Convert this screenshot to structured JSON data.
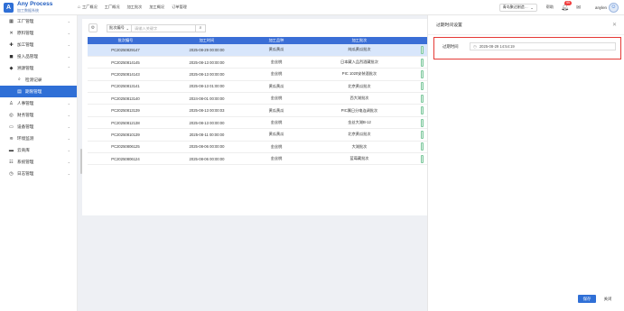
{
  "app": {
    "logo_mark": "A",
    "title": "Any Process",
    "subtitle": "加工数据系统"
  },
  "topnav": [
    {
      "icon": "⌂",
      "label": "工厂概况"
    },
    {
      "icon": "",
      "label": "工厂概况"
    },
    {
      "icon": "",
      "label": "加工批次"
    },
    {
      "icon": "",
      "label": "加工概况"
    },
    {
      "icon": "",
      "label": "订单管理"
    }
  ],
  "header": {
    "factory": "青岛聚达制造…",
    "help": "帮助",
    "notification_count": "99",
    "user": "anylen"
  },
  "sidebar": {
    "items": [
      {
        "icon": "▦",
        "label": "工厂管理",
        "chev": "⌄"
      },
      {
        "icon": "✕",
        "label": "原料管理",
        "chev": "⌄"
      },
      {
        "icon": "✚",
        "label": "加工管理",
        "chev": "⌄"
      },
      {
        "icon": "◼",
        "label": "投入品管理",
        "chev": "⌄"
      },
      {
        "icon": "◆",
        "label": "溯源管理",
        "chev": "⌃"
      },
      {
        "icon": "⌕",
        "label": "检测记录",
        "chev": ""
      },
      {
        "icon": "▤",
        "label": "期限管理",
        "chev": ""
      },
      {
        "icon": "♙",
        "label": "人事管理",
        "chev": "⌄"
      },
      {
        "icon": "◎",
        "label": "财务管理",
        "chev": "⌄"
      },
      {
        "icon": "▭",
        "label": "设备管理",
        "chev": "⌄"
      },
      {
        "icon": "≋",
        "label": "环境监测",
        "chev": "⌄"
      },
      {
        "icon": "▬",
        "label": "云商库",
        "chev": "⌄"
      },
      {
        "icon": "☷",
        "label": "系统管理",
        "chev": "⌄"
      },
      {
        "icon": "◷",
        "label": "日志管理",
        "chev": "⌄"
      }
    ]
  },
  "toolbar": {
    "gear": "⚙",
    "filter_field": "批次编号",
    "search_placeholder": "请输入关键字",
    "search_icon": "⌕"
  },
  "table": {
    "columns": [
      "批次编号",
      "加工时间",
      "加工品种",
      "加工批次"
    ],
    "rows": [
      [
        "PC20250829147",
        "2025-08-29 00:00:00",
        "黄瓜黄瓜",
        "纯瓜黄瓜批次"
      ],
      [
        "PC20250814145",
        "2025-08-13 00:00:00",
        "金丝桃",
        "日本藏入品烈酒藏批次"
      ],
      [
        "PC20250814143",
        "2025-08-13 00:00:00",
        "金丝桃",
        "PIC 1020安装酒批次"
      ],
      [
        "PC20250813141",
        "2025-08-13 01:00:00",
        "黄瓜黄瓜",
        "北京黄瓜批次"
      ],
      [
        "PC20250813140",
        "2024-08-01 00:00:00",
        "金丝桃",
        "西大湖批次"
      ],
      [
        "PC20250813139",
        "2025-08-13 00:00:03",
        "黄瓜黄瓜",
        "PIC属日分电连调批次"
      ],
      [
        "PC20250812138",
        "2025-08-13 00:00:00",
        "金丝桃",
        "金丝大湖B-12"
      ],
      [
        "PC20250810139",
        "2025-08-11 00:00:00",
        "黄瓜黄瓜",
        "北京黄瓜批次"
      ],
      [
        "PC20250806125",
        "2025-08-06 00:00:00",
        "金丝桃",
        "大湖批次"
      ],
      [
        "PC20250806124",
        "2025-08-06 00:00:00",
        "金丝桃",
        "蓝莓藏批次"
      ]
    ],
    "selected_row": 0
  },
  "drawer": {
    "title": "过期时间设置",
    "close_icon": "✕",
    "field_label": "过期时间",
    "field_icon": "◷",
    "field_value": "2025-08-29 14:54:19",
    "save": "保存",
    "cancel": "关闭"
  },
  "colors": {
    "primary": "#2f6fd6",
    "header_row": "#3a6ed6",
    "highlight": "#e53935"
  }
}
